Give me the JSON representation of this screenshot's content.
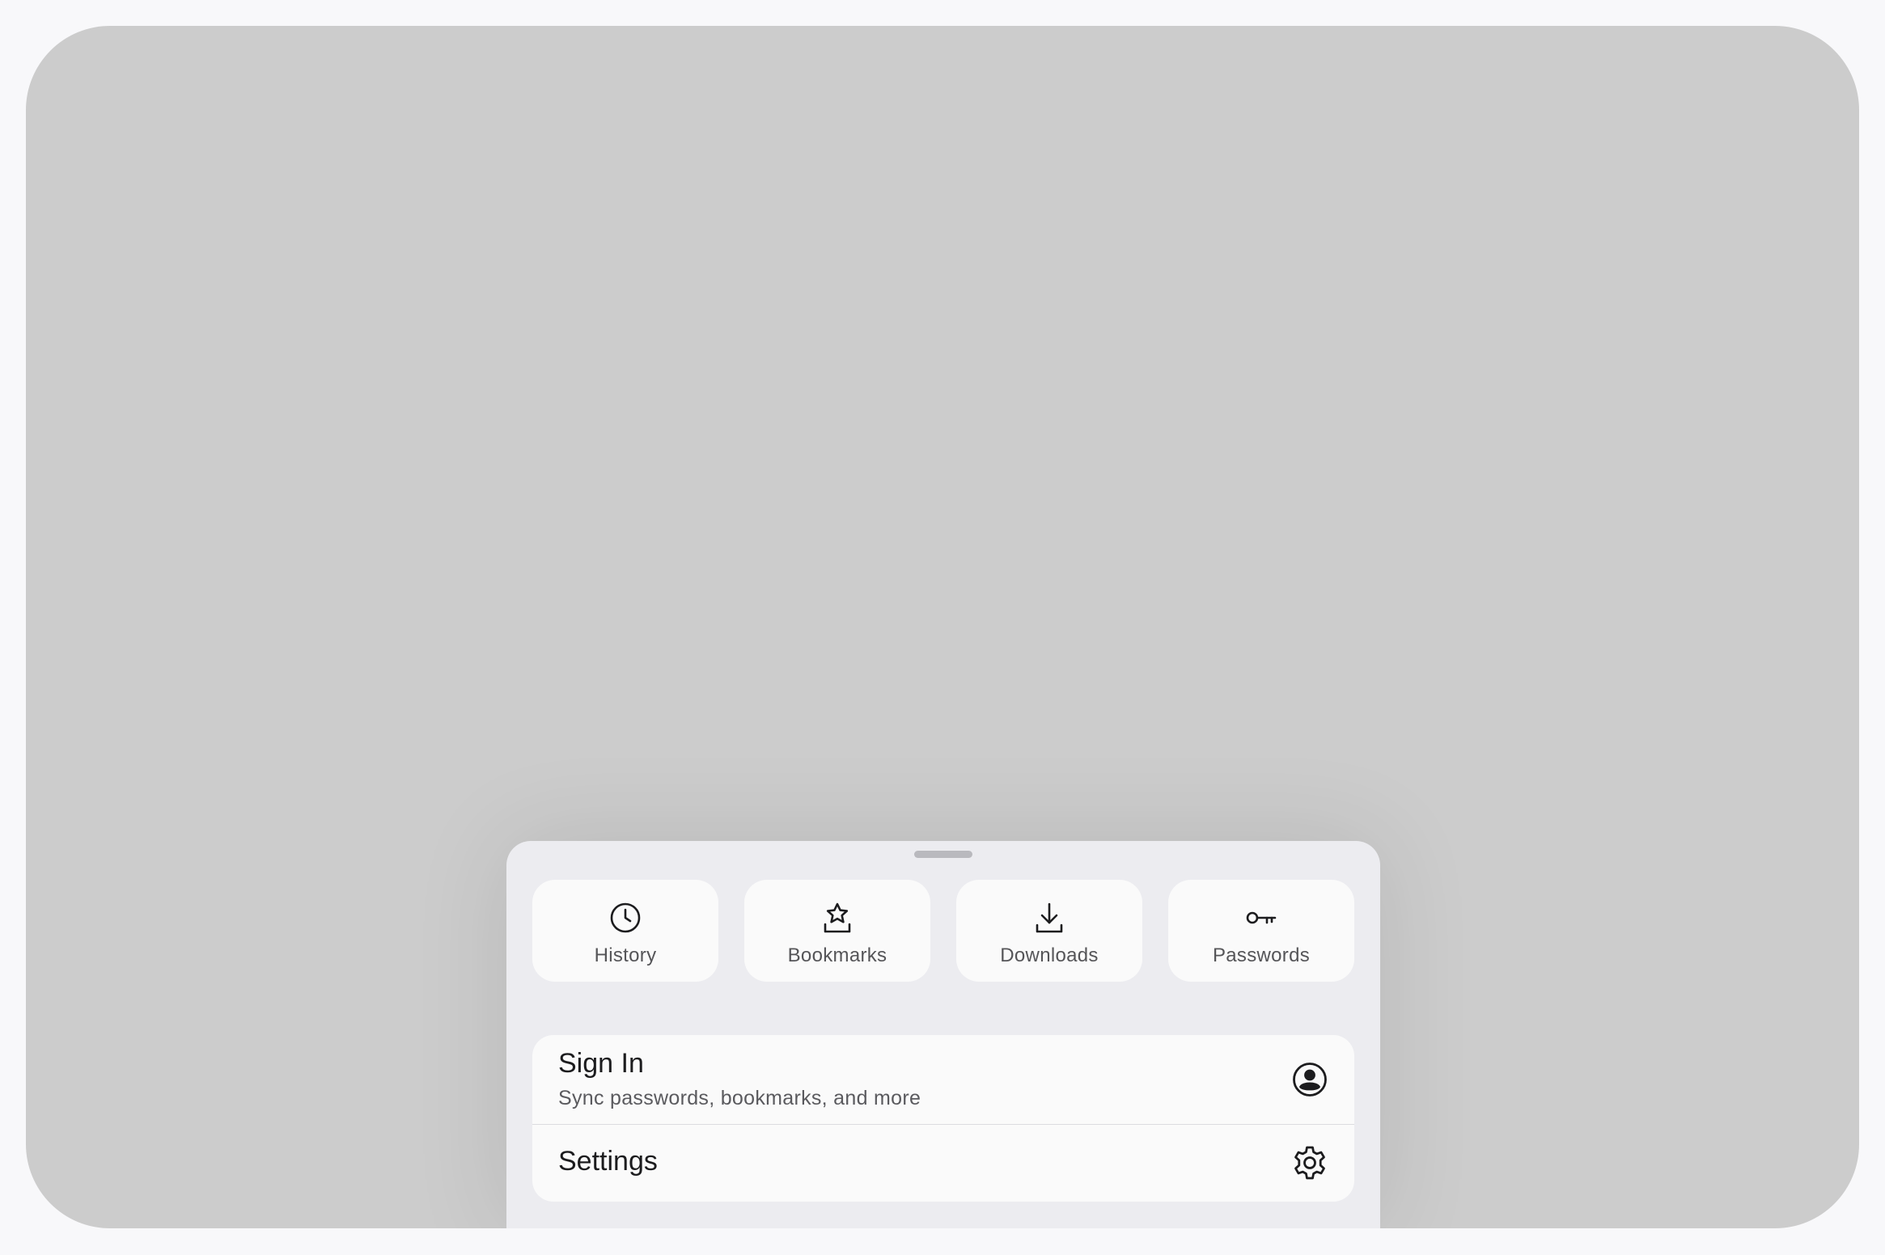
{
  "quick_actions": [
    {
      "label": "History",
      "icon": "clock-icon"
    },
    {
      "label": "Bookmarks",
      "icon": "bookmark-star-icon"
    },
    {
      "label": "Downloads",
      "icon": "download-icon"
    },
    {
      "label": "Passwords",
      "icon": "key-icon"
    }
  ],
  "account": {
    "title": "Sign In",
    "subtitle": "Sync passwords, bookmarks, and more",
    "icon": "account-circle-icon"
  },
  "settings": {
    "title": "Settings",
    "icon": "gear-icon"
  },
  "colors": {
    "backdrop": "#cccccc",
    "sheet": "#ececf0",
    "card": "#fafafa",
    "text_primary": "#1c1c1e",
    "text_secondary": "#5a5a5e"
  }
}
